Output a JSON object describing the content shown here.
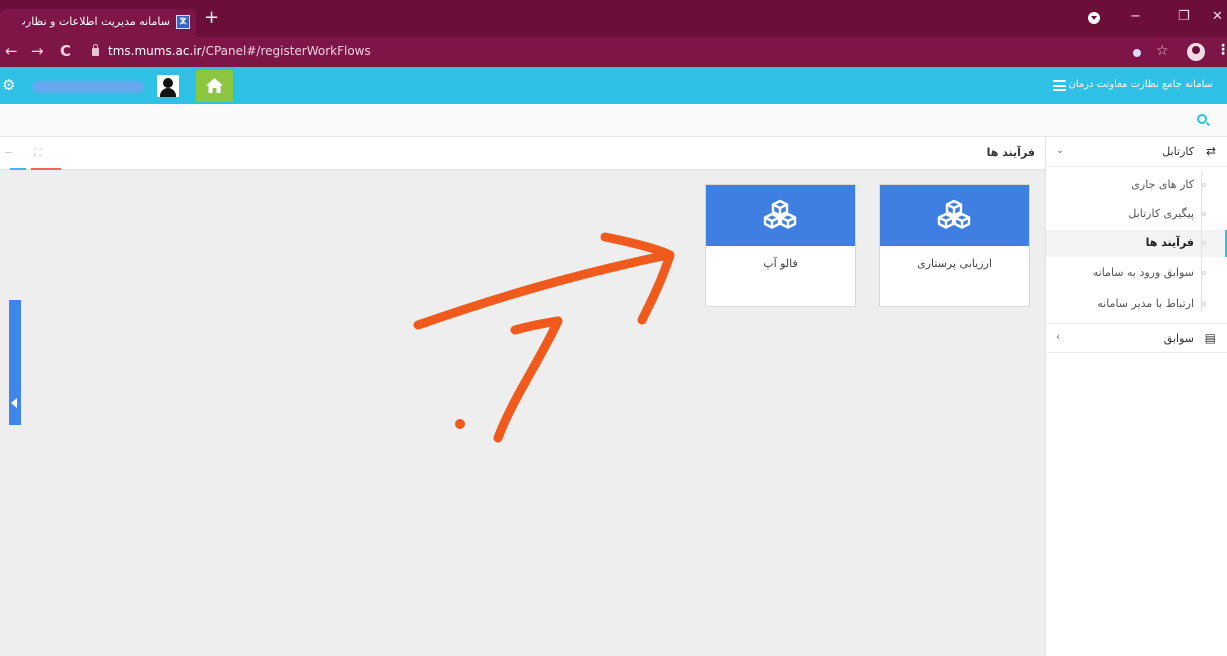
{
  "browser": {
    "tab_title": "سامانه مدیریت اطلاعات و نظارت د",
    "tab_close": "×",
    "new_tab": "+",
    "favicon": "?",
    "url_host": "tms.mums.ac.ir",
    "url_path": "/CPanel#/registerWorkFlows",
    "back": "←",
    "forward": "→",
    "reload": "C",
    "minimize": "−",
    "maximize": "❐",
    "close": "✕",
    "star": "☆",
    "menu": "⋮"
  },
  "header": {
    "app_title": "سامانه جامع نظارت معاونت درمان"
  },
  "panel": {
    "title": "فرآیند ها",
    "ctrl_collapse": "−",
    "ctrl_expand": "⛶"
  },
  "cards": [
    {
      "label": "ارزیابی پرستاری"
    },
    {
      "label": "فالو آپ"
    }
  ],
  "sidebar": {
    "group_kartabl": "کارتابل",
    "group_kartabl_chevron": "⌄",
    "items": [
      {
        "label": "کار های جاری"
      },
      {
        "label": "پیگیری کارتابل"
      },
      {
        "label": "فرآیند ها",
        "active": true
      },
      {
        "label": "سوابق ورود به سامانه"
      },
      {
        "label": "ارتباط با مدیر سامانه"
      }
    ],
    "group_savabegh": "سوابق",
    "group_savabegh_chevron": "‹"
  },
  "colors": {
    "tab_strip": "#6b0e3a",
    "header": "#2ec1e5",
    "home_button": "#8cc63f",
    "card_accent": "#3f7fe2",
    "annotation": "#f05a1c"
  },
  "icons": {
    "settings": "gear-icon",
    "home": "home-icon",
    "user": "user-icon",
    "search": "search-icon",
    "card": "cubes-icon",
    "retweet": "retweet-icon",
    "archive": "archive-icon"
  }
}
